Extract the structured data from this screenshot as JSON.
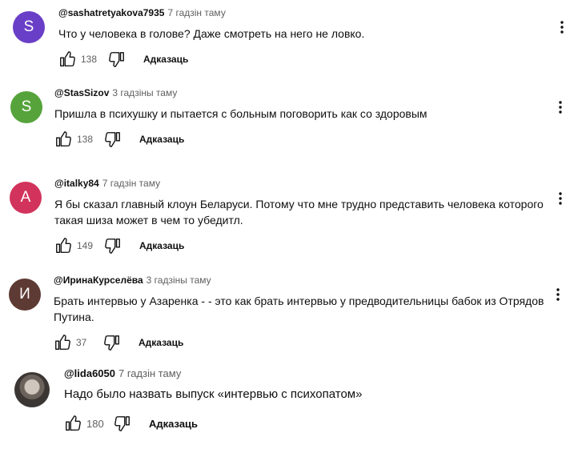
{
  "comments": [
    {
      "avatar_letter": "S",
      "avatar_color": "#6a3fc7",
      "author": "@sashatretyakova7935",
      "time": "7 гадзін таму",
      "text": "Что у человека в голове? Даже смотреть на него не ловко.",
      "likes": "138",
      "reply_label": "Адказаць"
    },
    {
      "avatar_letter": "S",
      "avatar_color": "#56a33c",
      "author": "@StasSizov",
      "time": "3 гадзіны таму",
      "text": "Пришла в психушку и пытается с больным поговорить как со здоровым",
      "likes": "138",
      "reply_label": "Адказаць"
    },
    {
      "avatar_letter": "A",
      "avatar_color": "#d2335c",
      "author": "@italky84",
      "time": "7 гадзін таму",
      "text": "Я бы сказал главный клоун Беларуси. Потому что мне трудно представить человека которого такая шиза может в чем то убедитл.",
      "likes": "149",
      "reply_label": "Адказаць"
    },
    {
      "avatar_letter": "И",
      "avatar_color": "#5d3a33",
      "author": "@ИринаКурселёва",
      "time": "3 гадзіны таму",
      "text": "Брать интервью у Азаренка - - это как брать интервью у предводительницы бабок из Отрядов Путина.",
      "likes": "37",
      "reply_label": "Адказаць"
    },
    {
      "avatar_letter": "",
      "avatar_color": "#4a4340",
      "author": "@lida6050",
      "time": "7 гадзін таму",
      "text": "Надо было назвать выпуск «интервью с психопатом»",
      "likes": "180",
      "reply_label": "Адказаць"
    }
  ]
}
